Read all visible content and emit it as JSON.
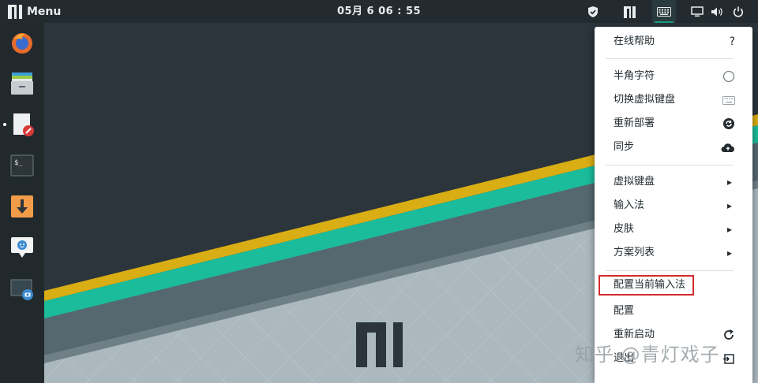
{
  "top_panel": {
    "menu_label": "Menu",
    "clock": "05月 6  06 : 55",
    "tray_icons": [
      "shield-icon",
      "manjaro-icon",
      "keyboard-icon",
      "display-icon",
      "volume-icon",
      "power-icon"
    ]
  },
  "dock": {
    "items": [
      "firefox-icon",
      "file-manager-icon",
      "text-editor-icon",
      "terminal-icon",
      "downloader-icon",
      "chat-icon",
      "screenshot-icon"
    ],
    "running_indicator": "text-editor-icon"
  },
  "context_menu": {
    "items": [
      {
        "label": "在线帮助",
        "right": "?"
      },
      {
        "label": "半角字符",
        "right_icon": "circle-icon"
      },
      {
        "label": "切换虚拟键盘",
        "right_icon": "keyboard-icon"
      },
      {
        "label": "重新部署",
        "right_icon": "redeploy-icon"
      },
      {
        "label": "同步",
        "right_icon": "cloud-sync-icon"
      },
      {
        "label": "虚拟键盘",
        "submenu": true
      },
      {
        "label": "输入法",
        "submenu": true
      },
      {
        "label": "皮肤",
        "submenu": true
      },
      {
        "label": "方案列表",
        "submenu": true
      },
      {
        "label": "配置当前输入法",
        "highlighted": true
      },
      {
        "label": "配置"
      },
      {
        "label": "重新启动",
        "right_icon": "restart-icon"
      },
      {
        "label": "退出",
        "right_icon": "exit-icon"
      }
    ],
    "submenu_arrow": "▸",
    "highlight_color": "#d22c2c"
  },
  "watermark": "知乎 @青灯戏子",
  "colors": {
    "panel": "#232b30",
    "accent_teal": "#1abc9c",
    "accent_yellow": "#f1c40f",
    "wallpaper_dark": "#2b353b",
    "wallpaper_light": "#a9b7bc"
  }
}
